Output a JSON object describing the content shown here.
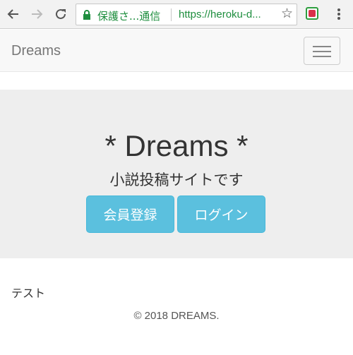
{
  "browser": {
    "security_label": "保護さ...通信",
    "url": "https://heroku-d...",
    "icons": [
      "back-arrow-icon",
      "forward-arrow-icon",
      "reload-icon",
      "lock-icon",
      "star-icon",
      "extension-icon",
      "menu-icon"
    ]
  },
  "navbar": {
    "brand": "Dreams"
  },
  "jumbotron": {
    "title": "* Dreams *",
    "subtitle": "小説投稿サイトです",
    "register_label": "会員登録",
    "login_label": "ログイン"
  },
  "content": {
    "text": "テスト"
  },
  "footer": {
    "copyright": "© 2018 DREAMS."
  },
  "colors": {
    "button": "#5bc0de",
    "jumbotron_bg": "#eeeeee",
    "navbar_bg": "#f8f8f8",
    "secure_green": "#1e8e3e"
  }
}
